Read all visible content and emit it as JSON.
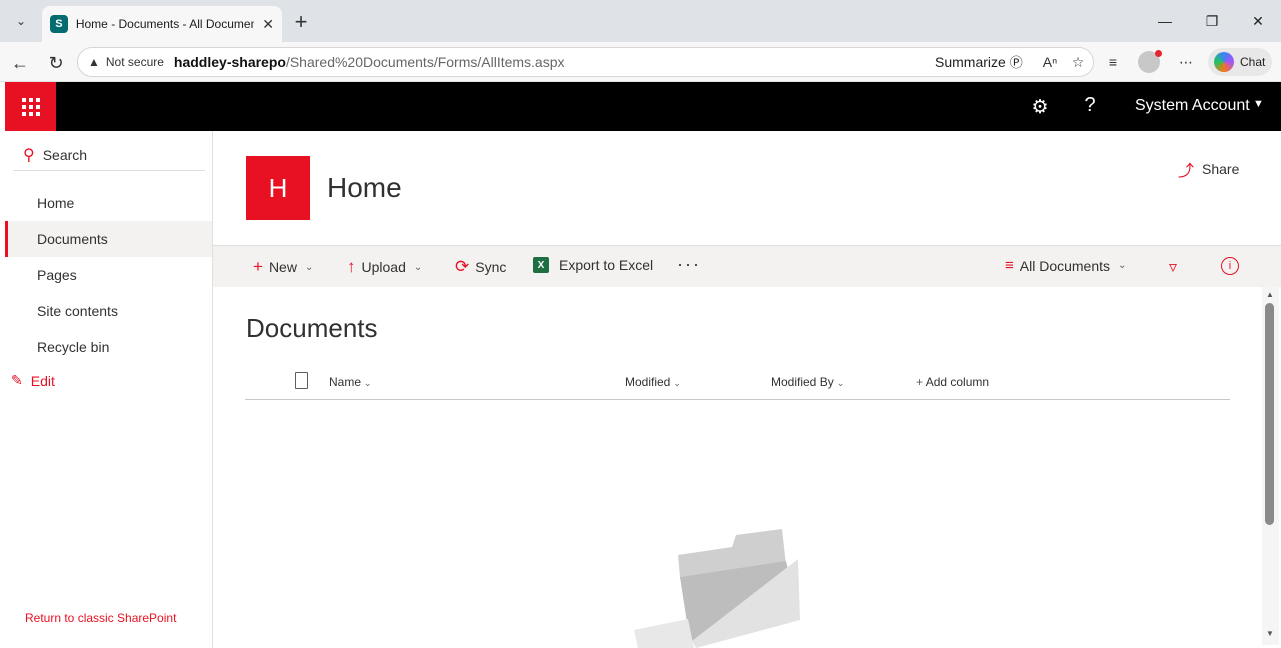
{
  "browser": {
    "tab_title": "Home - Documents - All Documents",
    "tab_favicon": "S",
    "address": {
      "security_label": "Not secure",
      "host": "haddley-sharepo",
      "path": "/Shared%20Documents/Forms/AllItems.aspx"
    },
    "summarize_label": "Summarize",
    "chat_label": "Chat"
  },
  "suitebar": {
    "account_name": "System Account",
    "help_glyph": "?"
  },
  "leftnav": {
    "search_label": "Search",
    "items": [
      {
        "label": "Home"
      },
      {
        "label": "Documents"
      },
      {
        "label": "Pages"
      },
      {
        "label": "Site contents"
      },
      {
        "label": "Recycle bin"
      }
    ],
    "edit_label": "Edit",
    "classic_link": "Return to classic SharePoint"
  },
  "header": {
    "logo_letter": "H",
    "site_title": "Home",
    "share_label": "Share"
  },
  "commandbar": {
    "new_label": "New",
    "upload_label": "Upload",
    "sync_label": "Sync",
    "export_label": "Export to Excel",
    "view_label": "All Documents"
  },
  "library": {
    "title": "Documents",
    "columns": {
      "name": "Name",
      "modified": "Modified",
      "modified_by": "Modified By",
      "add_column": "Add column"
    }
  },
  "colors": {
    "accent": "#e81123",
    "suitebar": "#000000",
    "commandbar_bg": "#f3f2f1"
  }
}
